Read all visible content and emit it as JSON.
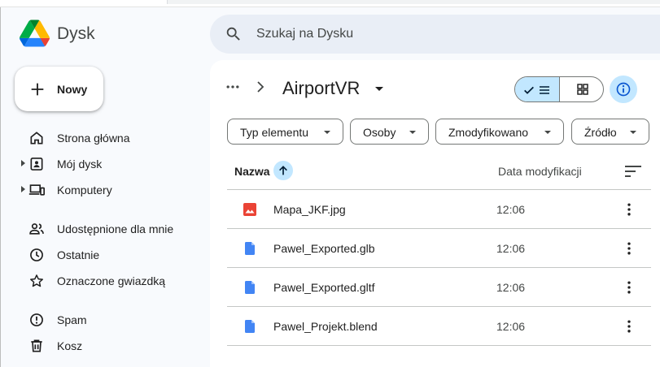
{
  "app": {
    "name": "Dysk",
    "logo": "google-drive-logo",
    "colors": {
      "background": "#f8fafd",
      "accent_selected": "#c2e7ff",
      "search_bg": "#e9eef6",
      "blue": "#0b57d0",
      "doc_icon": "#4285f4",
      "image_icon": "#ea4335"
    }
  },
  "search": {
    "placeholder": "Szukaj na Dysku",
    "icon": "search-icon"
  },
  "new_button": {
    "label": "Nowy",
    "icon": "plus-icon"
  },
  "sidebar": {
    "items": [
      {
        "label": "Strona główna",
        "icon": "home-icon",
        "expandable": false
      },
      {
        "label": "Mój dysk",
        "icon": "my-drive-icon",
        "expandable": true
      },
      {
        "label": "Komputery",
        "icon": "computers-icon",
        "expandable": true
      },
      {
        "label": "Udostępnione dla mnie",
        "icon": "people-icon",
        "expandable": false
      },
      {
        "label": "Ostatnie",
        "icon": "clock-icon",
        "expandable": false
      },
      {
        "label": "Oznaczone gwiazdką",
        "icon": "star-icon",
        "expandable": false
      },
      {
        "label": "Spam",
        "icon": "spam-icon",
        "expandable": false
      },
      {
        "label": "Kosz",
        "icon": "trash-icon",
        "expandable": false
      }
    ]
  },
  "breadcrumb": {
    "current_folder": "AirportVR"
  },
  "view": {
    "mode": "list"
  },
  "filters": [
    {
      "label": "Typ elementu"
    },
    {
      "label": "Osoby"
    },
    {
      "label": "Zmodyfikowano"
    },
    {
      "label": "Źródło"
    }
  ],
  "table": {
    "columns": {
      "name": "Nazwa",
      "modified": "Data modyfikacji"
    },
    "sort": {
      "column": "name",
      "direction": "ascending"
    },
    "rows": [
      {
        "name": "Mapa_JKF.jpg",
        "modified": "12:06",
        "type": "image"
      },
      {
        "name": "Pawel_Exported.glb",
        "modified": "12:06",
        "type": "document"
      },
      {
        "name": "Pawel_Exported.gltf",
        "modified": "12:06",
        "type": "document"
      },
      {
        "name": "Pawel_Projekt.blend",
        "modified": "12:06",
        "type": "document"
      }
    ]
  }
}
